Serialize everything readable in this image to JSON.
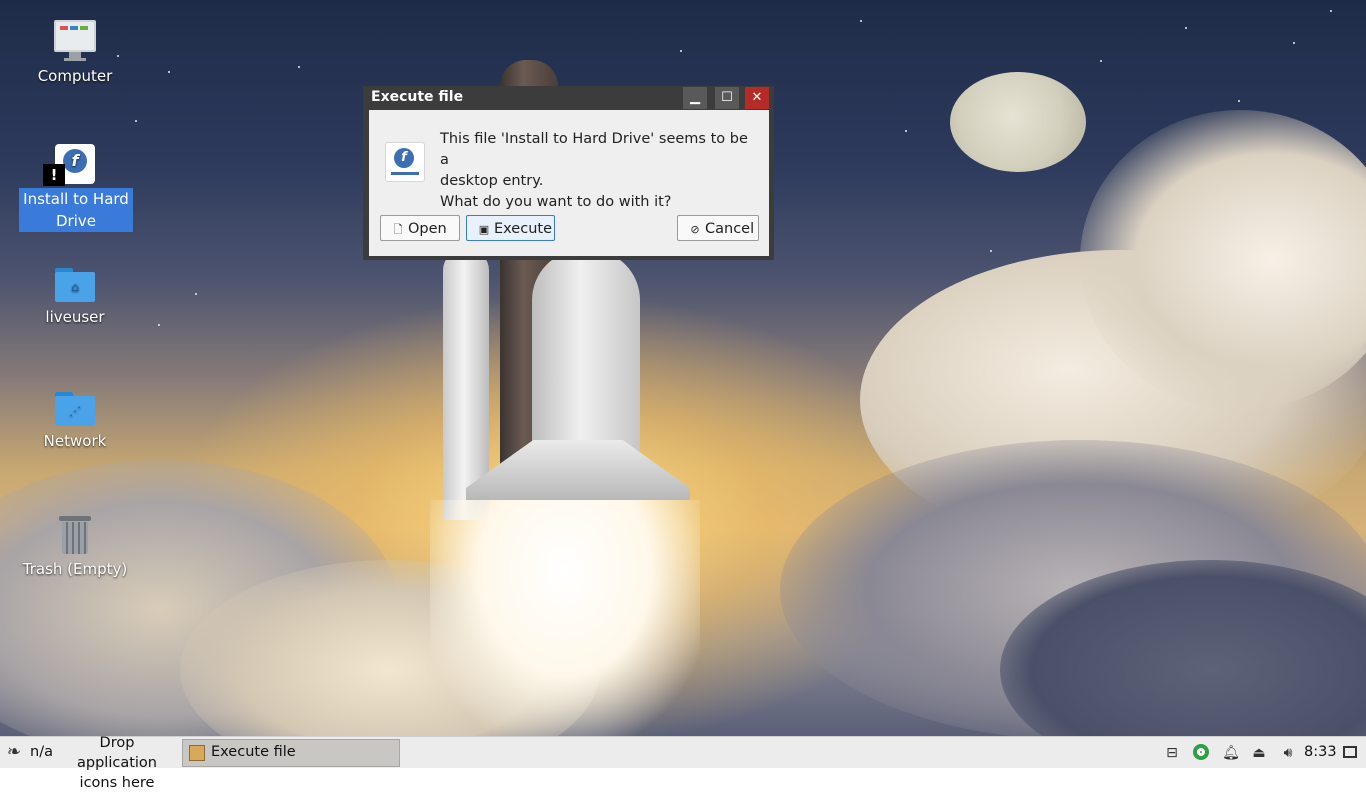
{
  "desktop": {
    "icons": [
      {
        "label": "Computer",
        "icon": "computer-icon"
      },
      {
        "label": "Install to Hard Drive",
        "icon": "fedora-installer-icon",
        "badge": "!"
      },
      {
        "label": "liveuser",
        "icon": "home-folder-icon"
      },
      {
        "label": "Network",
        "icon": "network-folder-icon"
      },
      {
        "label": "Trash (Empty)",
        "icon": "trash-icon"
      }
    ]
  },
  "dialog": {
    "title": "Execute file",
    "message_line1": "This file 'Install to Hard Drive' seems to be a",
    "message_line2": "desktop entry.",
    "message_line3": "What do you want to do with it?",
    "buttons": {
      "open": "Open",
      "execute": "Execute",
      "cancel": "Cancel"
    },
    "window_controls": {
      "minimize": "minimize-icon",
      "maximize": "maximize-icon",
      "close": "close-icon"
    }
  },
  "taskbar": {
    "workspace_label": "n/a",
    "drop_text_line1": "Drop application",
    "drop_text_line2": "icons here",
    "task_label": "Execute file",
    "clock": "8:33",
    "tray_icons": [
      "network-icon",
      "update-icon",
      "notification-bell-icon",
      "usb-icon",
      "volume-icon"
    ]
  },
  "colors": {
    "selection": "#3a7ad9",
    "close_button": "#b52b27",
    "titlebar": "#3c3c3c",
    "taskbar": "#ececec"
  }
}
